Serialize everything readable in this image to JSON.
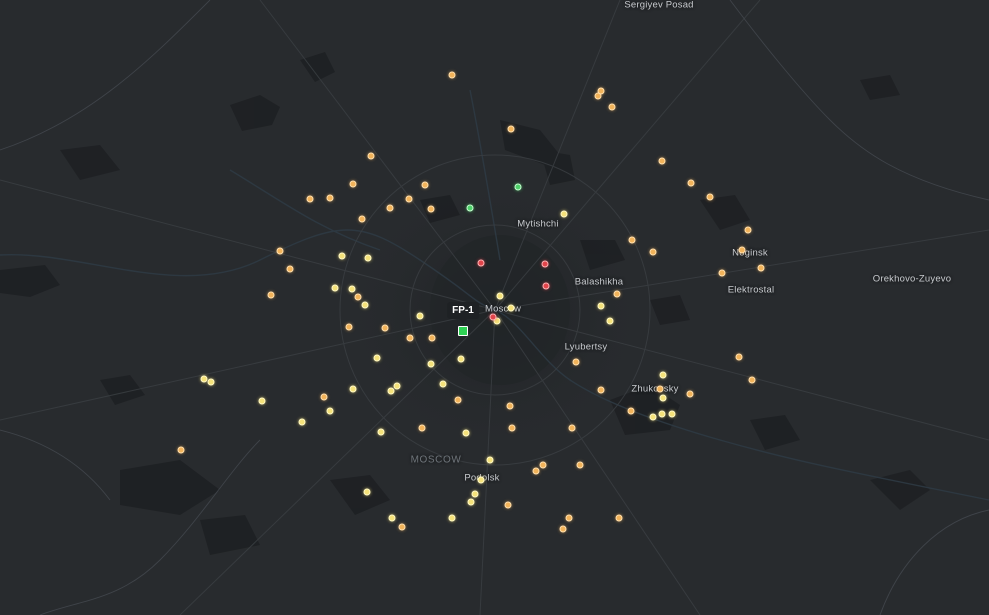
{
  "map": {
    "theme": "dark",
    "background_color": "#282b2e",
    "region_label": "MOSCOW",
    "cities": [
      {
        "name": "Sergiyev Posad",
        "lat": 56.31,
        "lon": 38.13
      },
      {
        "name": "Mytishchi",
        "lat": 55.91,
        "lon": 37.73
      },
      {
        "name": "Balashikha",
        "lat": 55.8,
        "lon": 37.94
      },
      {
        "name": "Moscow",
        "lat": 55.75,
        "lon": 37.62
      },
      {
        "name": "Noginsk",
        "lat": 55.85,
        "lon": 38.44
      },
      {
        "name": "Elektrostal",
        "lat": 55.79,
        "lon": 38.45
      },
      {
        "name": "Orekhovo-Zuyevo",
        "lat": 55.8,
        "lon": 38.98
      },
      {
        "name": "Lyubertsy",
        "lat": 55.68,
        "lon": 37.89
      },
      {
        "name": "Zhukovsky",
        "lat": 55.6,
        "lon": 38.12
      },
      {
        "name": "Podolsk",
        "lat": 55.43,
        "lon": 37.54
      }
    ],
    "station": {
      "label": "FP-1",
      "color": "#2fd154"
    },
    "marker_colors": {
      "yellow": "#f5e27a",
      "orange": "#f2b35a",
      "red": "#e2444a",
      "green": "#4fd16a"
    },
    "marker_counts": {
      "yellow": 38,
      "orange": 72,
      "red": 4,
      "green": 2
    }
  }
}
